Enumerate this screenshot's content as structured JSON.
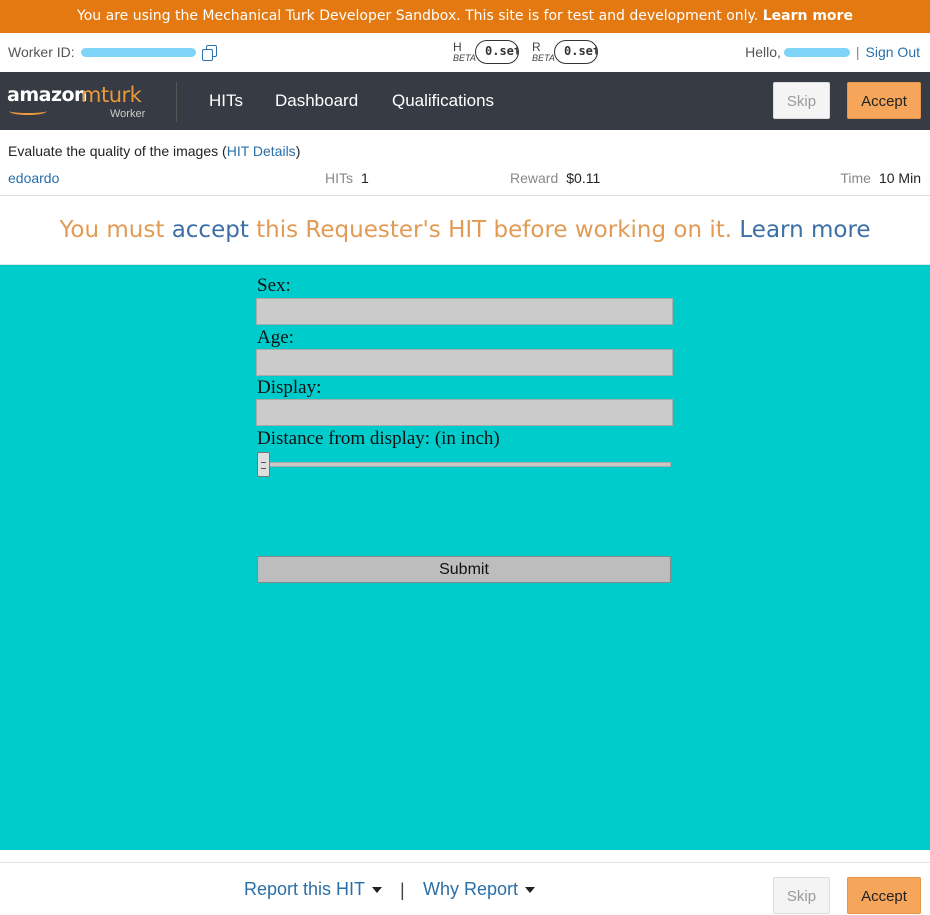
{
  "sandbox_banner": {
    "text": "You are using the Mechanical Turk Developer Sandbox. This site is for test and development only.",
    "link": "Learn more"
  },
  "worker": {
    "id_label": "Worker ID:"
  },
  "meters": [
    {
      "letter": "H",
      "beta": "BETA",
      "value": "0.set"
    },
    {
      "letter": "R",
      "beta": "BETA",
      "value": "0.set"
    }
  ],
  "greeting": {
    "hello": "Hello,",
    "sign_out": "Sign Out"
  },
  "nav": {
    "logo_amazon": "amazon",
    "logo_mturk": "mturk",
    "logo_role": "Worker",
    "links": [
      "HITs",
      "Dashboard",
      "Qualifications"
    ],
    "skip": "Skip",
    "accept": "Accept"
  },
  "hit": {
    "title": "Evaluate the quality of the images",
    "details_link": "HIT Details",
    "requester": "edoardo",
    "hits_label": "HITs",
    "hits_value": "1",
    "reward_label": "Reward",
    "reward_value": "$0.11",
    "time_label": "Time",
    "time_value": "10 Min"
  },
  "notice": {
    "part1": "You must",
    "accept_word": "accept",
    "part2": "this Requester's HIT before working on it.",
    "learn_more": "Learn more"
  },
  "form": {
    "sex_label": "Sex:",
    "sex_value": "",
    "age_label": "Age:",
    "age_value": "",
    "display_label": "Display:",
    "display_value": "",
    "distance_label": "Distance from display: (in inch)",
    "distance_level": 0,
    "submit": "Submit"
  },
  "footer": {
    "report": "Report this HIT",
    "why_report": "Why Report",
    "separator": "|",
    "skip": "Skip",
    "accept": "Accept"
  },
  "colors": {
    "sandbox_orange": "#e47911",
    "navbar": "#373b43",
    "accept_button": "#f6a65a",
    "work_area": "#00cccc",
    "link_blue": "#2a6fa8"
  }
}
